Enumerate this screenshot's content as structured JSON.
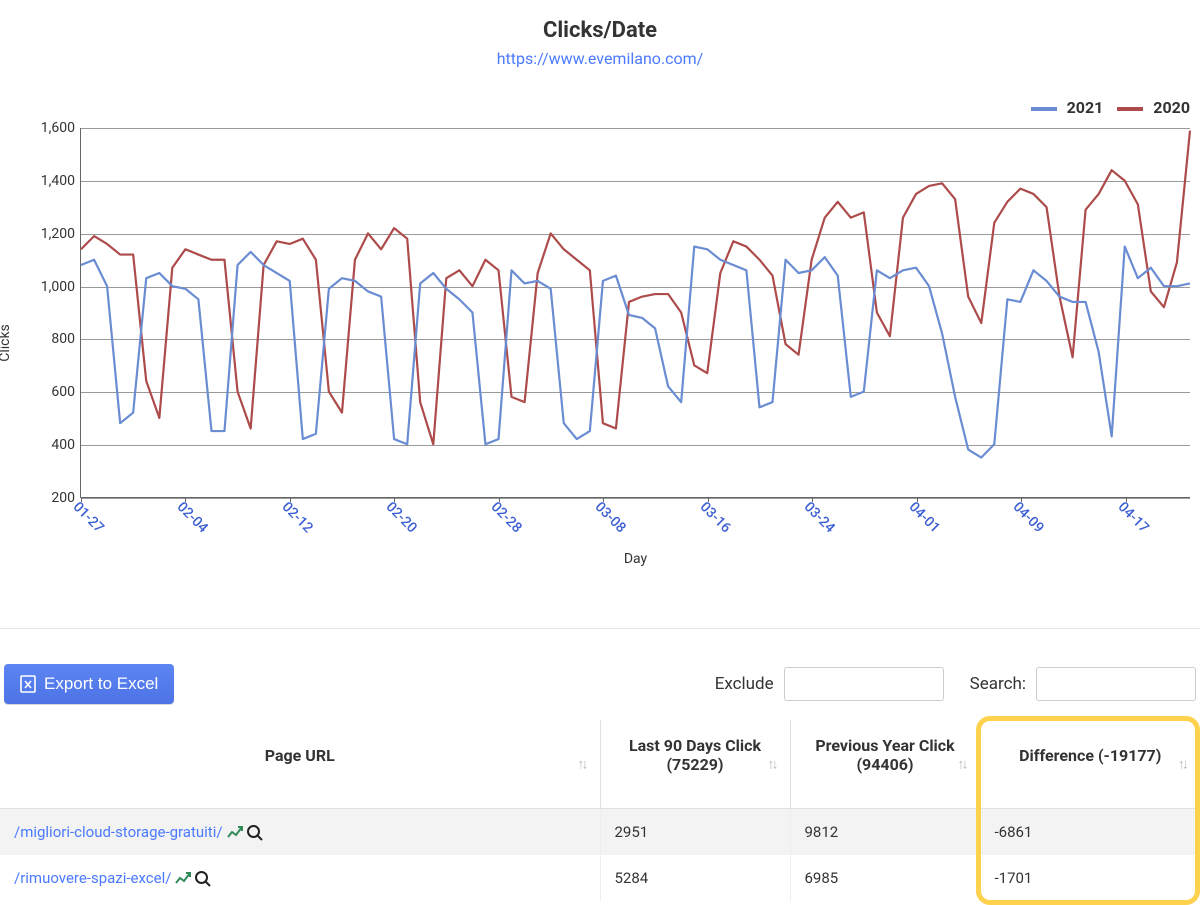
{
  "header": {
    "title": "Clicks/Date",
    "site_url": "https://www.evemilano.com/"
  },
  "chart_data": {
    "type": "line",
    "title": "Clicks/Date",
    "xlabel": "Day",
    "ylabel": "Clicks",
    "ylim": [
      200,
      1600
    ],
    "yticks": [
      200,
      400,
      600,
      800,
      1000,
      1200,
      1400,
      1600
    ],
    "xticks_shown": [
      "01-27",
      "02-04",
      "02-12",
      "02-20",
      "02-28",
      "03-08",
      "03-16",
      "03-24",
      "04-01",
      "04-09",
      "04-17"
    ],
    "x": [
      "01-27",
      "01-28",
      "01-29",
      "01-30",
      "01-31",
      "02-01",
      "02-02",
      "02-03",
      "02-04",
      "02-05",
      "02-06",
      "02-07",
      "02-08",
      "02-09",
      "02-10",
      "02-11",
      "02-12",
      "02-13",
      "02-14",
      "02-15",
      "02-16",
      "02-17",
      "02-18",
      "02-19",
      "02-20",
      "02-21",
      "02-22",
      "02-23",
      "02-24",
      "02-25",
      "02-26",
      "02-27",
      "02-28",
      "03-01",
      "03-02",
      "03-03",
      "03-04",
      "03-05",
      "03-06",
      "03-07",
      "03-08",
      "03-09",
      "03-10",
      "03-11",
      "03-12",
      "03-13",
      "03-14",
      "03-15",
      "03-16",
      "03-17",
      "03-18",
      "03-19",
      "03-20",
      "03-21",
      "03-22",
      "03-23",
      "03-24",
      "03-25",
      "03-26",
      "03-27",
      "03-28",
      "03-29",
      "03-30",
      "03-31",
      "04-01",
      "04-02",
      "04-03",
      "04-04",
      "04-05",
      "04-06",
      "04-07",
      "04-08",
      "04-09",
      "04-10",
      "04-11",
      "04-12",
      "04-13",
      "04-14",
      "04-15",
      "04-16",
      "04-17",
      "04-18",
      "04-19",
      "04-20",
      "04-21",
      "04-22"
    ],
    "series": [
      {
        "name": "2021",
        "color": "#6a8cd2",
        "values": [
          1080,
          1100,
          1000,
          480,
          520,
          1030,
          1050,
          1000,
          990,
          950,
          450,
          450,
          1080,
          1130,
          1080,
          1050,
          1020,
          420,
          440,
          990,
          1030,
          1020,
          980,
          960,
          420,
          400,
          1010,
          1050,
          990,
          950,
          900,
          400,
          420,
          1060,
          1010,
          1020,
          990,
          480,
          420,
          450,
          1020,
          1040,
          890,
          880,
          840,
          620,
          560,
          1150,
          1140,
          1100,
          1080,
          1060,
          540,
          560,
          1100,
          1050,
          1060,
          1110,
          1040,
          580,
          600,
          1060,
          1030,
          1060,
          1070,
          1000,
          820,
          580,
          380,
          350,
          400,
          950,
          940,
          1060,
          1020,
          960,
          940,
          940,
          750,
          430,
          1150,
          1030,
          1070,
          1000,
          1000,
          1010
        ]
      },
      {
        "name": "2020",
        "color": "#ad4b4b",
        "values": [
          1140,
          1190,
          1160,
          1120,
          1120,
          640,
          500,
          1070,
          1140,
          1120,
          1100,
          1100,
          600,
          460,
          1080,
          1170,
          1160,
          1180,
          1100,
          600,
          520,
          1100,
          1200,
          1140,
          1220,
          1180,
          560,
          400,
          1030,
          1060,
          1000,
          1100,
          1060,
          580,
          560,
          1050,
          1200,
          1140,
          1100,
          1060,
          480,
          460,
          940,
          960,
          970,
          970,
          900,
          700,
          670,
          1050,
          1170,
          1150,
          1100,
          1040,
          780,
          740,
          1100,
          1260,
          1320,
          1260,
          1280,
          900,
          810,
          1260,
          1350,
          1380,
          1390,
          1330,
          960,
          860,
          1240,
          1320,
          1370,
          1350,
          1300,
          960,
          730,
          1290,
          1350,
          1440,
          1400,
          1310,
          980,
          920,
          1090,
          1590
        ]
      }
    ]
  },
  "toolbar": {
    "export_label": "Export to Excel",
    "exclude_label": "Exclude",
    "search_label": "Search:",
    "exclude_value": "",
    "search_value": ""
  },
  "table": {
    "columns": {
      "url": "Page URL",
      "last90": "Last 90 Days Click (75229)",
      "prevyear": "Previous Year Click (94406)",
      "diff": "Difference (-19177)"
    },
    "rows": [
      {
        "url": "/migliori-cloud-storage-gratuiti/",
        "last90": "2951",
        "prevyear": "9812",
        "diff": "-6861"
      },
      {
        "url": "/rimuovere-spazi-excel/",
        "last90": "5284",
        "prevyear": "6985",
        "diff": "-1701"
      }
    ]
  }
}
